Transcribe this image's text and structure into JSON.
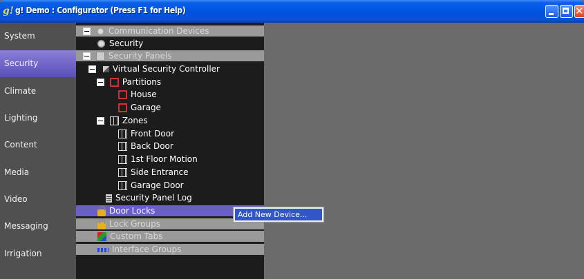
{
  "window": {
    "title": "g! Demo : Configurator   (Press F1 for Help)",
    "icon_glyph": "g!"
  },
  "sidebar": {
    "items": [
      {
        "label": "System"
      },
      {
        "label": "Security",
        "active": true
      },
      {
        "label": "Climate"
      },
      {
        "label": "Lighting"
      },
      {
        "label": "Content"
      },
      {
        "label": "Media"
      },
      {
        "label": "Video"
      },
      {
        "label": "Messaging"
      },
      {
        "label": "Irrigation"
      }
    ]
  },
  "tree": {
    "communication_devices": {
      "label": "Communication Devices",
      "children": [
        "Security"
      ]
    },
    "security_panels": {
      "label": "Security Panels",
      "controller": "Virtual Security Controller",
      "partitions": {
        "label": "Partitions",
        "children": [
          "House",
          "Garage"
        ]
      },
      "zones": {
        "label": "Zones",
        "children": [
          "Front Door",
          "Back Door",
          "1st Floor Motion",
          "Side Entrance",
          "Garage Door"
        ]
      },
      "log": "Security Panel Log"
    },
    "groups": {
      "door_locks": "Door Locks",
      "lock_groups": "Lock Groups",
      "custom_tabs": "Custom Tabs",
      "interface_groups": "Interface Groups"
    }
  },
  "context_menu": {
    "items": [
      "Add New Device..."
    ]
  },
  "colors": {
    "titlebar": "#0054e3",
    "sidebar_active": "#6a5fc8",
    "selected_group": "#6a5fc8",
    "menu_highlight": "#3156c8"
  }
}
